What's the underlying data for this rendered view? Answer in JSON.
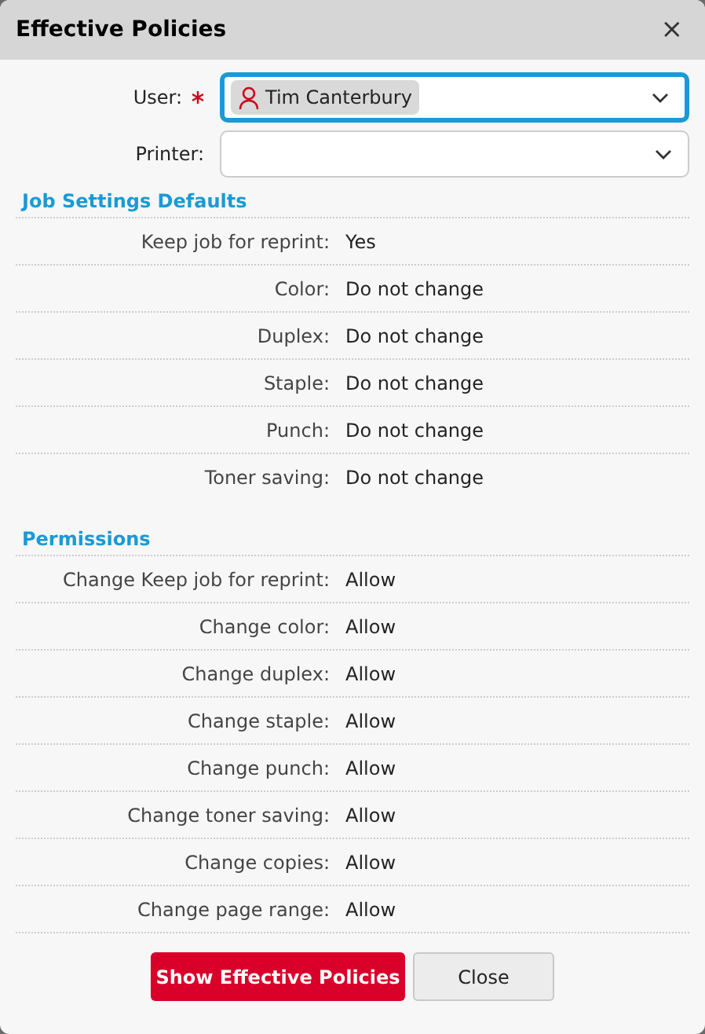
{
  "window": {
    "title": "Effective Policies",
    "close": "×"
  },
  "fields": [
    {
      "label": "User:",
      "required": true,
      "focused": true,
      "value": "Tim Canterbury"
    },
    {
      "label": "Printer:",
      "required": false,
      "focused": false
    }
  ],
  "sections": [
    {
      "title": "Job Settings Defaults",
      "rows": [
        {
          "label": "Keep job for reprint:",
          "value": "Yes"
        },
        {
          "label": "Color:",
          "value": "Do not change"
        },
        {
          "label": "Duplex:",
          "value": "Do not change"
        },
        {
          "label": "Staple:",
          "value": "Do not change"
        },
        {
          "label": "Punch:",
          "value": "Do not change"
        },
        {
          "label": "Toner saving:",
          "value": "Do not change"
        }
      ]
    },
    {
      "title": "Permissions",
      "rows": [
        {
          "label": "Change Keep job for reprint:",
          "value": "Allow"
        },
        {
          "label": "Change color:",
          "value": "Allow"
        },
        {
          "label": "Change duplex:",
          "value": "Allow"
        },
        {
          "label": "Change staple:",
          "value": "Allow"
        },
        {
          "label": "Change punch:",
          "value": "Allow"
        },
        {
          "label": "Change toner saving:",
          "value": "Allow"
        },
        {
          "label": "Change copies:",
          "value": "Allow"
        },
        {
          "label": "Change page range:",
          "value": "Allow"
        }
      ]
    }
  ],
  "buttons": [
    {
      "label": "Show Effective Policies",
      "kind": "primary"
    },
    {
      "label": "Close",
      "kind": "secondary"
    }
  ]
}
